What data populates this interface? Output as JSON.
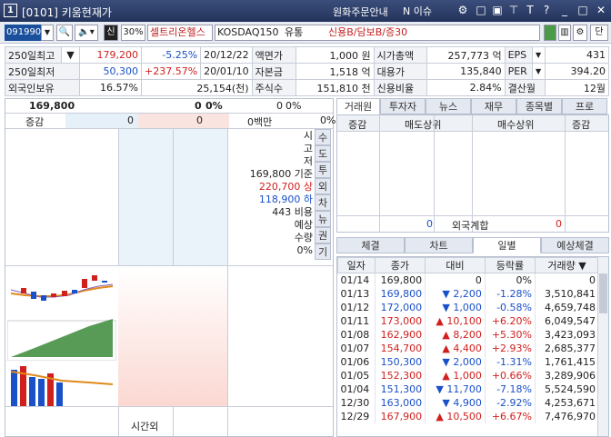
{
  "window": {
    "number": "1",
    "title": "[0101] 키움현재가",
    "link1": "원화주문안내",
    "link2": "N 이슈",
    "icons": [
      "settings-icon",
      "window-icon",
      "tile-icon",
      "pin-icon",
      "help-icon",
      "minimize-icon",
      "close-icon"
    ]
  },
  "toolbar": {
    "code": "091990",
    "badge": "신",
    "margin": "30%",
    "name": "셀트리온헬스",
    "market": "KOSDAQ150",
    "sector": "유통",
    "credit": "신용B/담보B/증30",
    "single_label": "단"
  },
  "info": {
    "r1": {
      "l1": "250일최고",
      "v1": "179,200",
      "p1": "-5.25%",
      "d1": "20/12/22",
      "l2": "액면가",
      "v2": "1,000 원",
      "l3": "시가총액",
      "v3": "257,773 억",
      "l4": "EPS",
      "v4": "431"
    },
    "r2": {
      "l1": "250일최저",
      "v1": "50,300",
      "p1": "+237.57%",
      "d1": "20/01/10",
      "l2": "자본금",
      "v2": "1,518 억",
      "l3": "대용가",
      "v3": "135,840",
      "l4": "PER",
      "v4": "394.20"
    },
    "r3": {
      "l1": "외국인보유",
      "v1": "16.57%",
      "v1b": "25,154(천)",
      "l2": "주식수",
      "v2": "151,810 천",
      "l3": "신용비율",
      "v3": "2.84%",
      "l4": "결산월",
      "v4": "12월"
    }
  },
  "orderbook": {
    "price": "169,800",
    "change": "0",
    "pct": "0%",
    "vol": "0",
    "vol_pct": "0%",
    "label_change": "증감",
    "c1": "0",
    "c2": "0",
    "c3": "0백만",
    "c4": "0%",
    "side_labels": [
      "시",
      "고",
      "저"
    ],
    "base": "169,800 기준",
    "upper": "220,700 상",
    "lower": "118,900 하",
    "ratio": "443 비용",
    "exp1": "예상",
    "exp2": "수량",
    "exp3": "0%",
    "vtabs": [
      "수",
      "도",
      "투",
      "외",
      "차",
      "뉴",
      "권",
      "기"
    ],
    "after_hours": "시간외"
  },
  "right_tabs": [
    "거래원",
    "투자자",
    "뉴스",
    "재무",
    "종목별",
    "프로"
  ],
  "broker": {
    "h1": "증감",
    "h2": "매도상위",
    "h3": "매수상위",
    "h4": "증감",
    "foreign_label": "외국계합",
    "foreign_sell": "0",
    "foreign_buy": "0"
  },
  "lower_tabs": [
    "체결",
    "차트",
    "일별",
    "예상체결"
  ],
  "daily": {
    "headers": [
      "일자",
      "종가",
      "대비",
      "등락률",
      "거래량"
    ],
    "rows": [
      {
        "date": "01/14",
        "close": "169,800",
        "arrow": "",
        "chg": "0",
        "pct": "0%",
        "vol": "0",
        "dir": "flat"
      },
      {
        "date": "01/13",
        "close": "169,800",
        "arrow": "▼",
        "chg": "2,200",
        "pct": "-1.28%",
        "vol": "3,510,841",
        "dir": "dn"
      },
      {
        "date": "01/12",
        "close": "172,000",
        "arrow": "▼",
        "chg": "1,000",
        "pct": "-0.58%",
        "vol": "4,659,748",
        "dir": "dn"
      },
      {
        "date": "01/11",
        "close": "173,000",
        "arrow": "▲",
        "chg": "10,100",
        "pct": "+6.20%",
        "vol": "6,049,547",
        "dir": "up"
      },
      {
        "date": "01/08",
        "close": "162,900",
        "arrow": "▲",
        "chg": "8,200",
        "pct": "+5.30%",
        "vol": "3,423,093",
        "dir": "up"
      },
      {
        "date": "01/07",
        "close": "154,700",
        "arrow": "▲",
        "chg": "4,400",
        "pct": "+2.93%",
        "vol": "2,685,377",
        "dir": "up"
      },
      {
        "date": "01/06",
        "close": "150,300",
        "arrow": "▼",
        "chg": "2,000",
        "pct": "-1.31%",
        "vol": "1,761,415",
        "dir": "dn"
      },
      {
        "date": "01/05",
        "close": "152,300",
        "arrow": "▲",
        "chg": "1,000",
        "pct": "+0.66%",
        "vol": "3,289,906",
        "dir": "up"
      },
      {
        "date": "01/04",
        "close": "151,300",
        "arrow": "▼",
        "chg": "11,700",
        "pct": "-7.18%",
        "vol": "5,524,590",
        "dir": "dn"
      },
      {
        "date": "12/30",
        "close": "163,000",
        "arrow": "▼",
        "chg": "4,900",
        "pct": "-2.92%",
        "vol": "4,253,671",
        "dir": "dn"
      },
      {
        "date": "12/29",
        "close": "167,900",
        "arrow": "▲",
        "chg": "10,500",
        "pct": "+6.67%",
        "vol": "7,476,970",
        "dir": "up"
      }
    ]
  },
  "colors": {
    "up": "#d0201e",
    "down": "#1a50c8",
    "title": "#2b3c66"
  }
}
